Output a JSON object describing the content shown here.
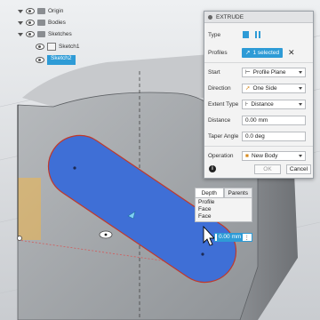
{
  "browser": {
    "items": [
      {
        "label": "Origin"
      },
      {
        "label": "Bodies"
      },
      {
        "label": "Sketches"
      },
      {
        "label": "Sketch1"
      },
      {
        "label": "Sketch2",
        "selected": true
      }
    ]
  },
  "extrude": {
    "title": "EXTRUDE",
    "type_label": "Type",
    "profiles_label": "Profiles",
    "profiles_value": "1 selected",
    "start_label": "Start",
    "start_value": "Profile Plane",
    "direction_label": "Direction",
    "direction_value": "One Side",
    "extent_label": "Extent Type",
    "extent_value": "Distance",
    "distance_label": "Distance",
    "distance_value": "0.00 mm",
    "taper_label": "Taper Angle",
    "taper_value": "0.0 deg",
    "operation_label": "Operation",
    "operation_value": "New Body",
    "ok_label": "OK",
    "cancel_label": "Cancel"
  },
  "popup": {
    "tabs": [
      "Depth",
      "Parents"
    ],
    "items": [
      "Profile",
      "Face",
      "Face"
    ],
    "distance_value": "0.00 mm"
  },
  "colors": {
    "accent": "#2e9bd6",
    "profile_fill": "#3f6fd6",
    "body": "#a3a6aa"
  }
}
